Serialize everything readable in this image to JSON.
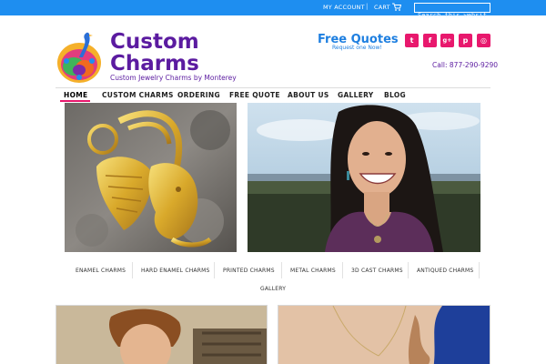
{
  "topbar": {
    "account_label": "MY ACCOUNT",
    "separator": "|",
    "cart_label": "CART",
    "cart_icon": "cart-icon",
    "search_placeholder": "Search this websit"
  },
  "header": {
    "brand_line1": "Custom",
    "brand_line2": "Charms",
    "tagline": "Custom Jewelry Charms by Monterey",
    "logo_icon": "peacock-logo-icon",
    "quotes_title": "Free Quotes",
    "quotes_sub": "Request one Now!",
    "social": [
      {
        "icon": "twitter-icon",
        "glyph": "t"
      },
      {
        "icon": "facebook-icon",
        "glyph": "f"
      },
      {
        "icon": "google-plus-icon",
        "glyph": "g+"
      },
      {
        "icon": "pinterest-icon",
        "glyph": "p"
      },
      {
        "icon": "instagram-icon",
        "glyph": "◎"
      }
    ],
    "phone": "Call: 877-290-9290"
  },
  "nav": {
    "items": [
      "HOME",
      "CUSTOM CHARMS",
      "ORDERING",
      "FREE QUOTE",
      "ABOUT US",
      "GALLERY",
      "BLOG"
    ],
    "active": "HOME"
  },
  "categories": {
    "items": [
      "ENAMEL CHARMS",
      "HARD ENAMEL CHARMS",
      "PRINTED CHARMS",
      "METAL CHARMS",
      "3D CAST CHARMS",
      "ANTIQUED CHARMS",
      "GALLERY"
    ]
  },
  "colors": {
    "topbar": "#1e8ef0",
    "brand_purple": "#5b1ba0",
    "quote_blue": "#1e7fe0",
    "social_pink": "#e8186d"
  }
}
